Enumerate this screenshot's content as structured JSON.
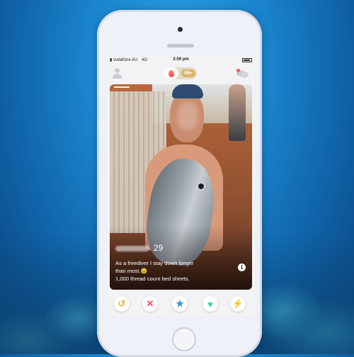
{
  "status_bar": {
    "carrier": "vodafone AU",
    "network": "4G",
    "time": "3:59 pm"
  },
  "nav": {
    "likes_badge": "99+"
  },
  "profile_card": {
    "age": "29",
    "bio_lines": [
      "As a freediver I stay down longer",
      "than most.😉",
      "1,000 thread count bed sheets."
    ],
    "info_symbol": "i"
  },
  "actions": {
    "rewind_symbol": "↺",
    "nope_symbol": "✕",
    "super_like_symbol": "★",
    "like_symbol": "♥",
    "boost_symbol": "⚡"
  },
  "icons": {
    "profile": "person-icon",
    "likes": "flame-icon",
    "messages": "chat-icon",
    "info": "info-icon",
    "rewind": "rewind-icon",
    "nope": "close-icon",
    "super_like": "star-icon",
    "like": "heart-icon",
    "boost": "bolt-icon"
  },
  "colors": {
    "brand_gradient": [
      "#ff8a6a",
      "#fd3a5c"
    ],
    "badge_gold": "#d9b26b",
    "rewind": "#f0b43a",
    "nope": "#f24a5d",
    "super_like": "#2f93e8",
    "like": "#31d5a2",
    "boost": "#9b4ee6"
  }
}
